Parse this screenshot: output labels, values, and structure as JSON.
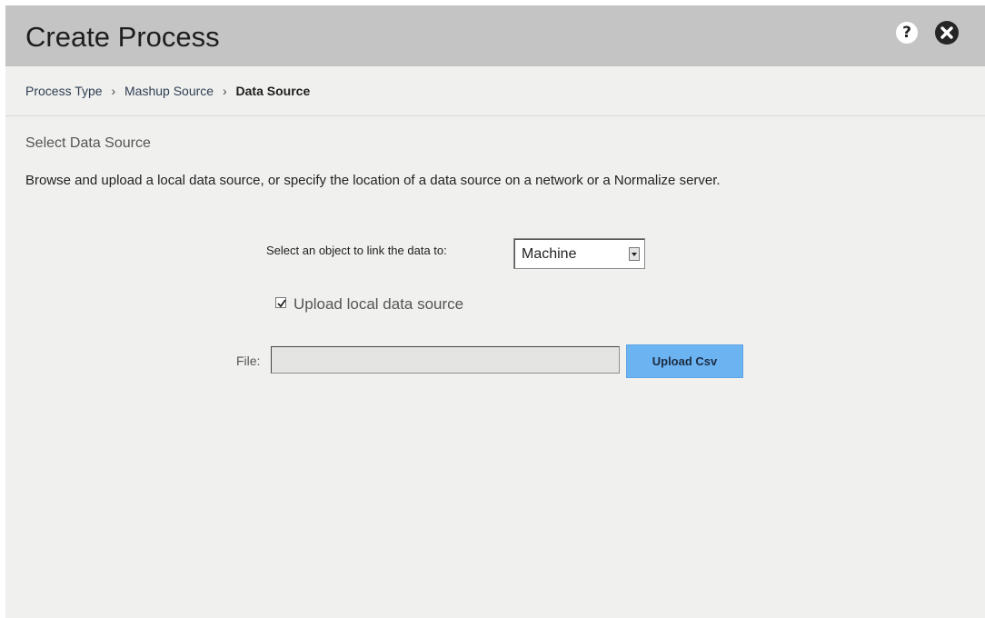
{
  "dialog": {
    "title": "Create Process",
    "help_glyph": "?",
    "icons": [
      "help-icon",
      "close-icon"
    ]
  },
  "breadcrumb": {
    "items": [
      "Process Type",
      "Mashup Source",
      "Data Source"
    ],
    "separator": "›"
  },
  "section": {
    "title": "Select Data Source",
    "description": "Browse and upload a local data source, or specify the location of a data source on a network or a Normalize server."
  },
  "form": {
    "link_label": "Select an object to link the data to:",
    "link_select_value": "Machine",
    "upload_checkbox_label": "Upload local data source",
    "upload_checkbox_checked": true,
    "file_label": "File:",
    "file_value": "",
    "upload_button_label": "Upload Csv"
  },
  "colors": {
    "titlebar": "#c4c4c4",
    "body": "#f0f0ef",
    "upload_button": "#6cb3f2"
  }
}
